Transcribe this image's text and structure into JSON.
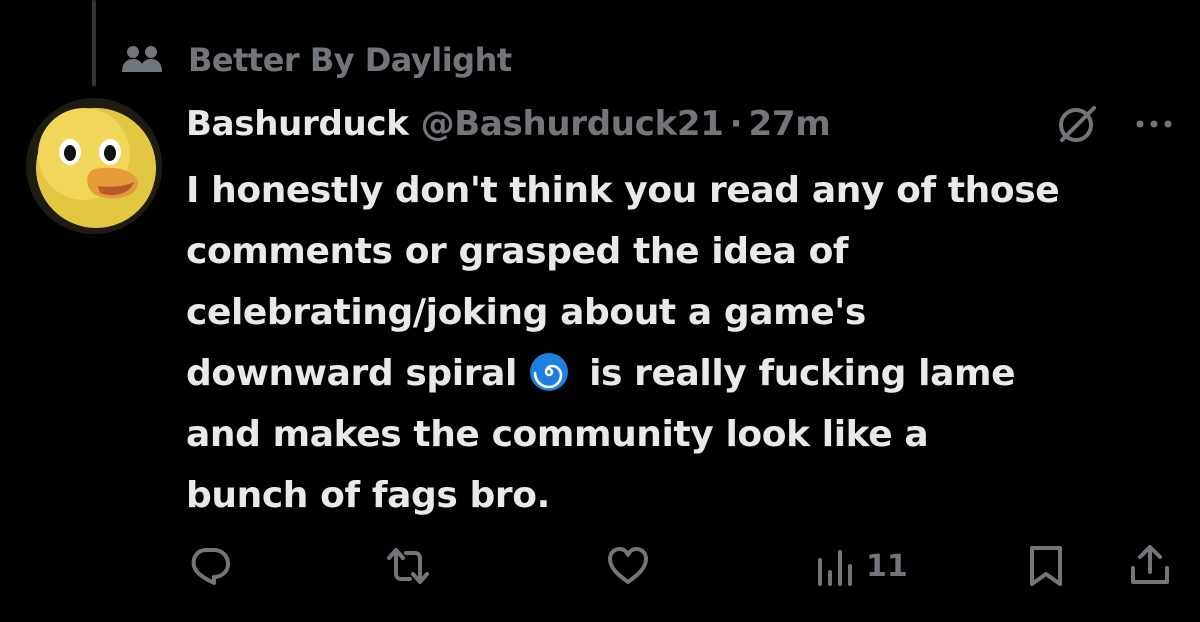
{
  "context": {
    "icon": "community-icon",
    "label": "Better By Daylight"
  },
  "post": {
    "avatar": "duck-avatar",
    "display_name": "Bashurduck",
    "handle": "@Bashurduck21",
    "separator": "·",
    "time": "27m",
    "header_icons": [
      "grok-icon",
      "more-icon"
    ],
    "text_lines": [
      "I honestly don't think you read any of those",
      "comments or grasped the idea of",
      "celebrating/joking about a game's",
      "downward spiral",
      "is really fucking lame",
      "and makes the community look like a",
      "bunch of fags bro."
    ],
    "emoji": "cyclone-emoji"
  },
  "actions": {
    "reply_icon": "reply-icon",
    "repost_icon": "repost-icon",
    "like_icon": "like-icon",
    "views_icon": "views-icon",
    "views_count": "11",
    "bookmark_icon": "bookmark-icon",
    "share_icon": "share-icon"
  },
  "colors": {
    "background": "#000000",
    "primary_text": "#e7e9ea",
    "secondary_text": "#71767b",
    "emoji_blue": "#1d7fe0"
  }
}
